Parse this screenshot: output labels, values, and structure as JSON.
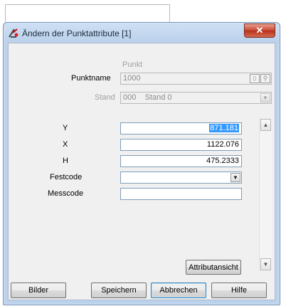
{
  "window": {
    "title": "Ändern der Punktattribute [1]",
    "close_glyph": "✕"
  },
  "form": {
    "section_label": "Punkt",
    "punktname_label": "Punktname",
    "punktname_value": "1000",
    "stand_label": "Stand",
    "stand_value": "000    Stand 0",
    "y_label": "Y",
    "y_value": "871.181",
    "x_label": "X",
    "x_value": "1122.076",
    "h_label": "H",
    "h_value": "475.2333",
    "festcode_label": "Festcode",
    "festcode_value": "",
    "messcode_label": "Messcode",
    "messcode_value": ""
  },
  "buttons": {
    "attribute_view": "Attributansicht",
    "bilder": "Bilder",
    "speichern": "Speichern",
    "abbrechen": "Abbrechen",
    "hilfe": "Hilfe"
  },
  "icons": {
    "app": "survey-point-icon",
    "pick": "pick-point-icon",
    "search": "search-point-icon"
  }
}
